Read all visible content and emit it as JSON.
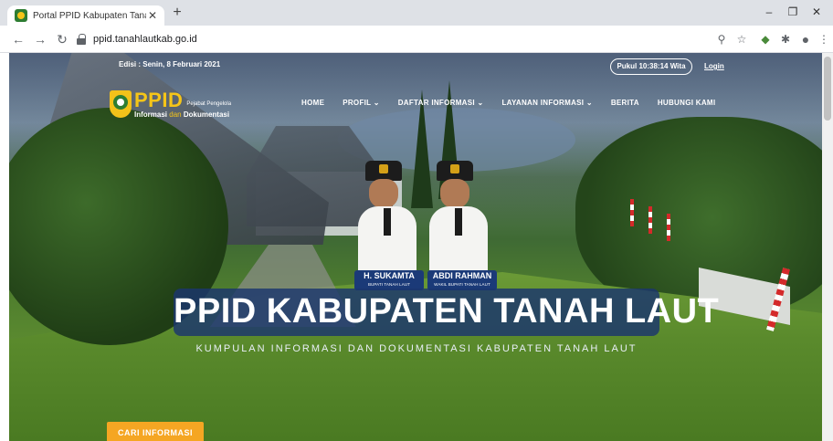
{
  "browser": {
    "tab_title": "Portal PPID Kabupaten Tanah Laut",
    "new_tab_label": "+",
    "url": "ppid.tanahlautkab.go.id",
    "icons": [
      "back-icon",
      "forward-icon",
      "reload-icon",
      "lock-icon",
      "zoom-icon",
      "star-icon",
      "extension-icon",
      "puzzle-icon",
      "profile-icon",
      "menu-icon"
    ]
  },
  "header": {
    "edition": "Edisi : Senin, 8 Februari 2021",
    "clock": "Pukul 10:38:14 Wita",
    "login": "Login"
  },
  "logo": {
    "mark": "PPID",
    "tagline": "Pejabat Pengelola",
    "sub_strong": "Informasi",
    "sub_small": "dan",
    "sub_end": "Dokumentasi"
  },
  "nav": {
    "items": [
      {
        "label": "HOME"
      },
      {
        "label": "PROFIL ⌄"
      },
      {
        "label": "DAFTAR INFORMASI ⌄"
      },
      {
        "label": "LAYANAN INFORMASI ⌄"
      },
      {
        "label": "BERITA"
      },
      {
        "label": "HUBUNGI KAMI"
      }
    ]
  },
  "officials": [
    {
      "name": "H. SUKAMTA",
      "role": "BUPATI TANAH LAUT"
    },
    {
      "name": "ABDI RAHMAN",
      "role": "WAKIL BUPATI TANAH LAUT"
    }
  ],
  "hero": {
    "title": "PPID KABUPATEN TANAH LAUT",
    "subtitle": "KUMPULAN INFORMASI DAN DOKUMENTASI KABUPATEN TANAH LAUT",
    "cta": "CARI INFORMASI"
  },
  "colors": {
    "accent": "#f5c518",
    "cta": "#f5a623",
    "title_box": "#1b366e"
  }
}
